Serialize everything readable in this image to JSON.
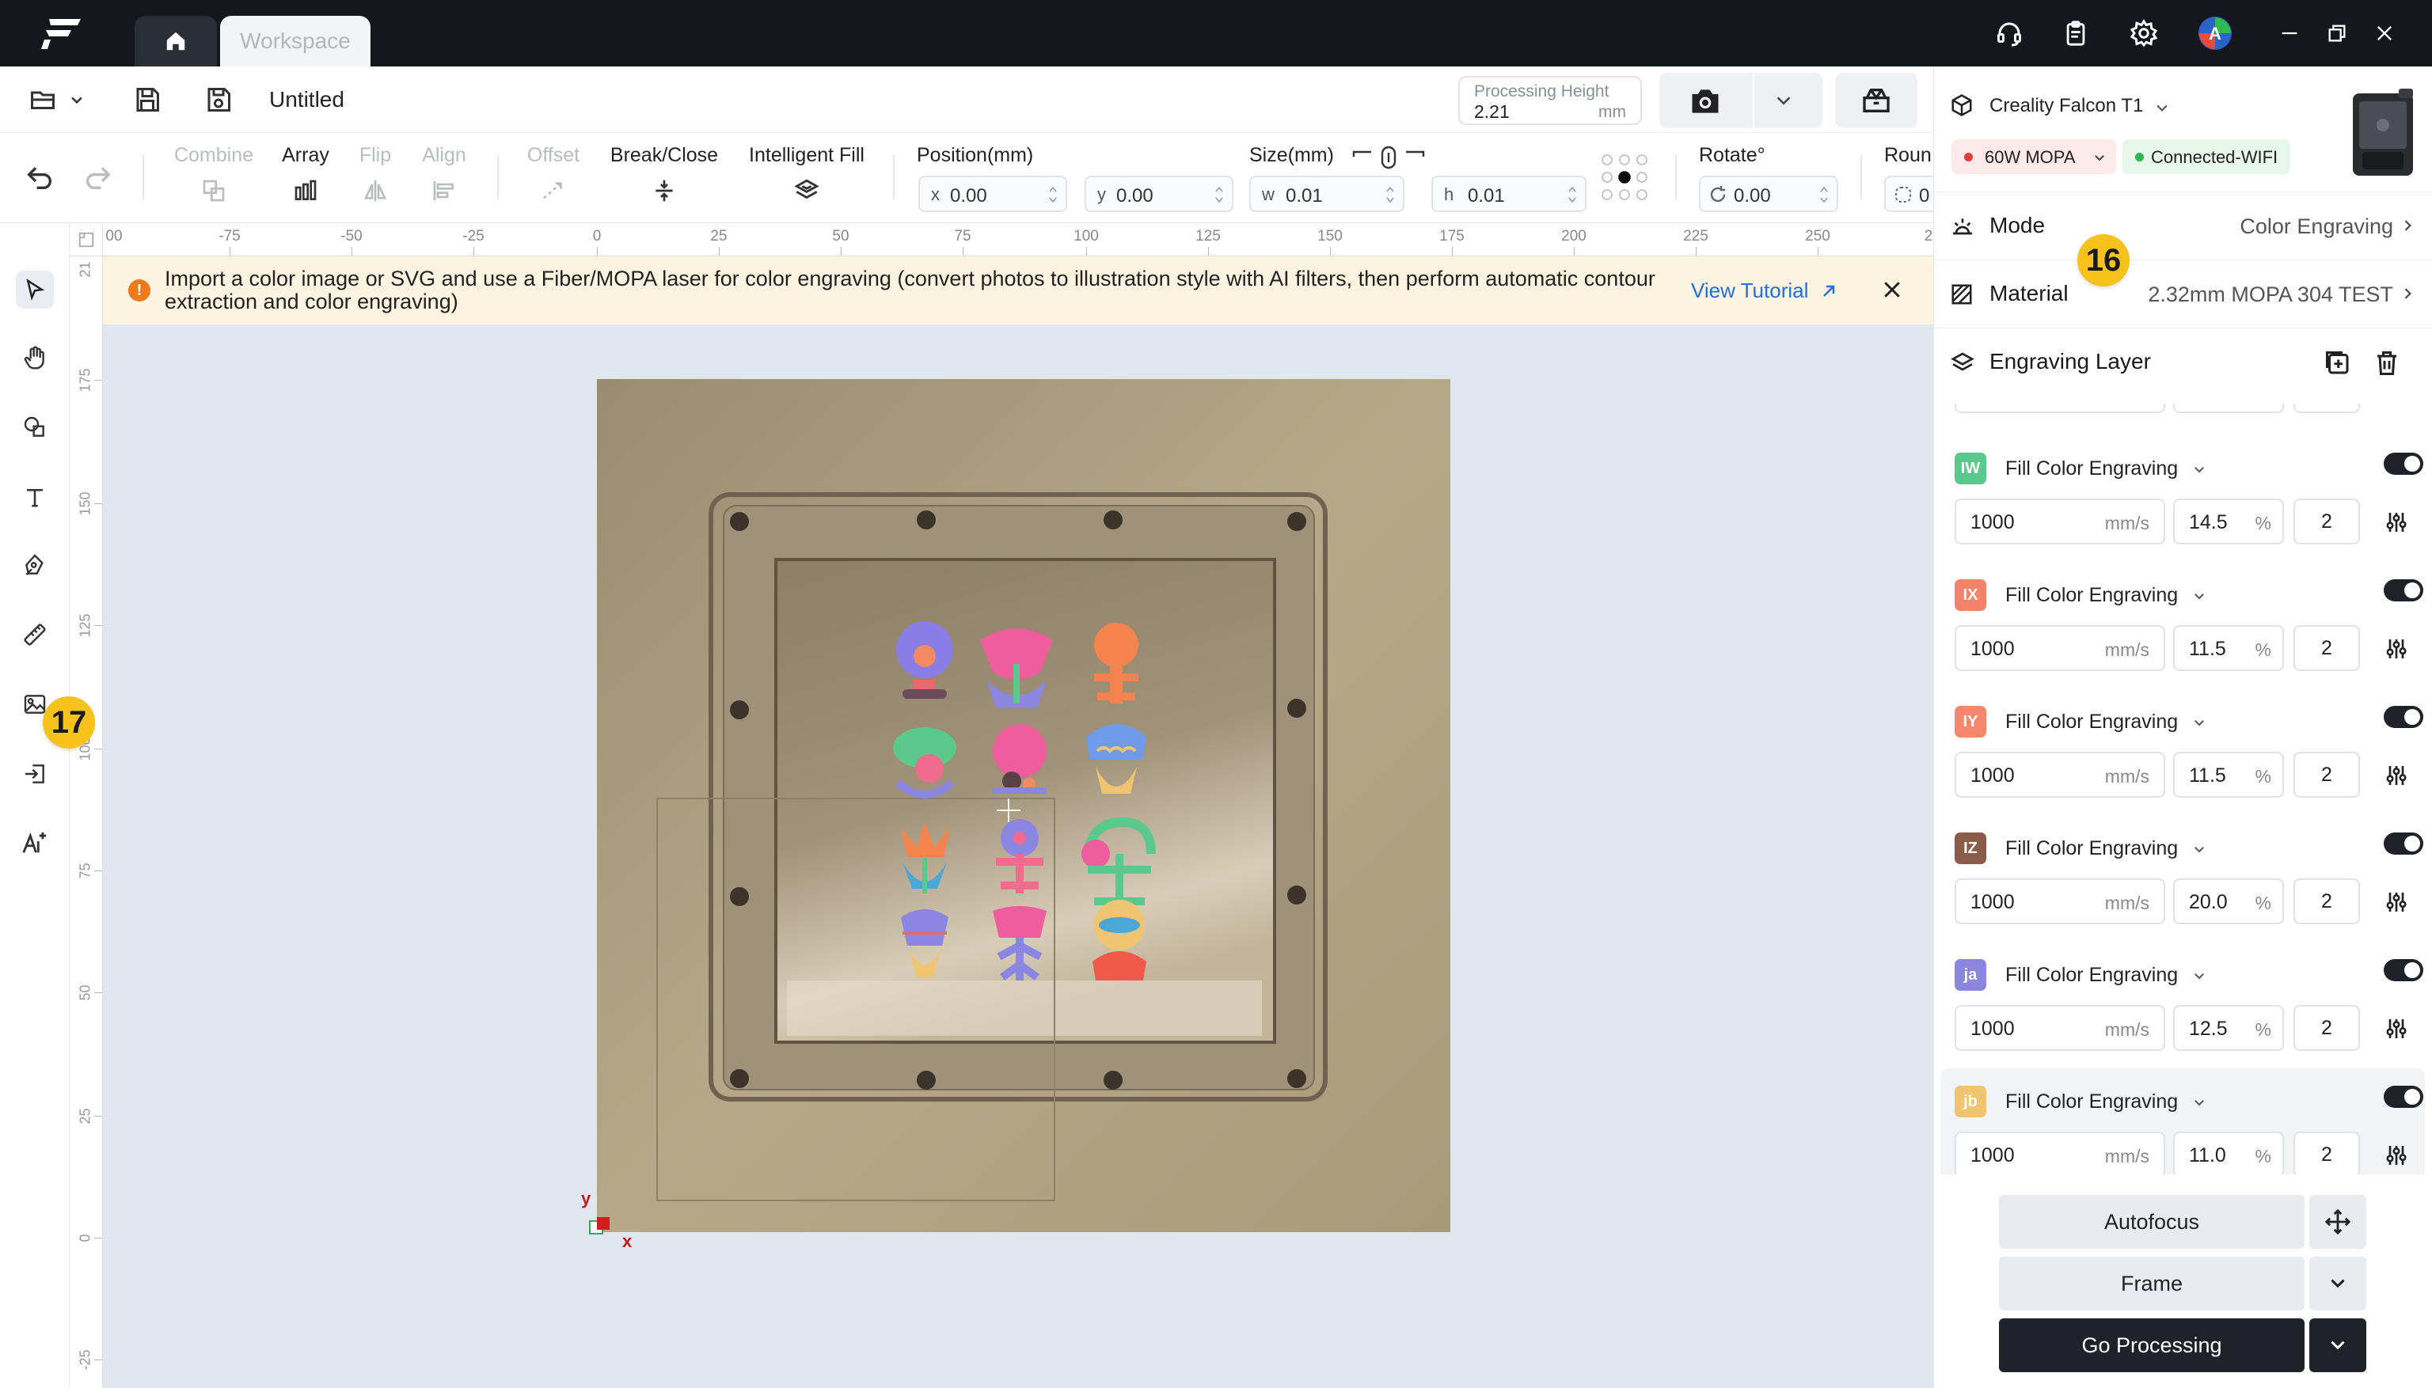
{
  "titlebar": {
    "workspace_tab": "Workspace",
    "icons": [
      "app-logo",
      "home-icon",
      "headset-icon",
      "clipboard-icon",
      "gear-icon",
      "avatar",
      "minimize-icon",
      "restore-icon",
      "close-icon"
    ]
  },
  "toolbar": {
    "doc_title": "Untitled",
    "processing_height": {
      "label": "Processing Height",
      "value": "2.21",
      "unit": "mm"
    }
  },
  "edit_tools": {
    "combine": "Combine",
    "array": "Array",
    "flip": "Flip",
    "align": "Align",
    "offset": "Offset",
    "break_close": "Break/Close",
    "intelligent_fill": "Intelligent Fill",
    "position_label": "Position(mm)",
    "x_prefix": "x",
    "x_value": "0.00",
    "y_prefix": "y",
    "y_value": "0.00",
    "size_label": "Size(mm)",
    "w_prefix": "w",
    "w_value": "0.01",
    "h_prefix": "h",
    "h_value": "0.01",
    "rotate_label": "Rotate°",
    "rotate_value": "0.00",
    "round_label": "Roun",
    "round_value": "0"
  },
  "rulers": {
    "top": [
      "00",
      "-75",
      "-50",
      "-25",
      "0",
      "25",
      "50",
      "75",
      "100",
      "125",
      "150",
      "175",
      "200",
      "225",
      "250",
      "2"
    ],
    "left": [
      "21",
      "175",
      "150",
      "125",
      "100",
      "75",
      "50",
      "25",
      "0",
      "-25"
    ]
  },
  "banner": {
    "text": "Import a color image or SVG and use a Fiber/MOPA laser for color engraving (convert photos to illustration style with AI filters, then perform automatic contour extraction and color engraving)",
    "link": "View Tutorial"
  },
  "canvas": {
    "axis_y": "y",
    "axis_x": "x"
  },
  "badges": {
    "right": "16",
    "left": "17"
  },
  "device": {
    "name": "Creality Falcon T1",
    "laser": "60W MOPA",
    "connection": "Connected-WIFI"
  },
  "panel": {
    "mode_label": "Mode",
    "mode_value": "Color Engraving",
    "material_label": "Material",
    "material_value": "2.32mm MOPA 304 TEST",
    "layer_title": "Engraving Layer"
  },
  "layers": [
    {
      "code": "IW",
      "color": "#5cc98c",
      "name": "Fill Color Engraving",
      "speed": "1000",
      "speed_unit": "mm/s",
      "power": "14.5",
      "power_unit": "%",
      "passes": "2"
    },
    {
      "code": "IX",
      "color": "#f3836a",
      "name": "Fill Color Engraving",
      "speed": "1000",
      "speed_unit": "mm/s",
      "power": "11.5",
      "power_unit": "%",
      "passes": "2"
    },
    {
      "code": "IY",
      "color": "#f4876c",
      "name": "Fill Color Engraving",
      "speed": "1000",
      "speed_unit": "mm/s",
      "power": "11.5",
      "power_unit": "%",
      "passes": "2"
    },
    {
      "code": "IZ",
      "color": "#8a5a4a",
      "name": "Fill Color Engraving",
      "speed": "1000",
      "speed_unit": "mm/s",
      "power": "20.0",
      "power_unit": "%",
      "passes": "2"
    },
    {
      "code": "ja",
      "color": "#8b86e0",
      "name": "Fill Color Engraving",
      "speed": "1000",
      "speed_unit": "mm/s",
      "power": "12.5",
      "power_unit": "%",
      "passes": "2"
    },
    {
      "code": "jb",
      "color": "#f0c471",
      "name": "Fill Color Engraving",
      "speed": "1000",
      "speed_unit": "mm/s",
      "power": "11.0",
      "power_unit": "%",
      "passes": "2"
    }
  ],
  "actions": {
    "autofocus": "Autofocus",
    "frame": "Frame",
    "go": "Go Processing"
  }
}
